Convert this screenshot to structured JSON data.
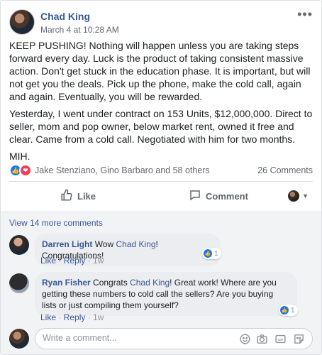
{
  "post": {
    "author": "Chad King",
    "timestamp": "March 4 at 10:28 AM",
    "more_icon": "more-horizontal-icon",
    "paragraphs": [
      "KEEP PUSHING! Nothing will happen unless you are taking steps forward every day. Luck is the product of taking consistent massive action. Don't get stuck in the education phase. It is important, but will not get you the deals. Pick up the phone, make the cold call, again and again. Eventually, you will be rewarded.",
      "Yesterday, I went under contract on 153 Units, $12,000,000. Direct to seller, mom and pop owner, below market rent, owned it free and clear. Came from a cold call. Negotiated with him for two months.",
      "MIH."
    ]
  },
  "reactions": {
    "icons": [
      "like-reaction-icon",
      "love-reaction-icon"
    ],
    "summary": "Jake Stenziano, Gino Barbaro and 58 others",
    "comment_count": "26 Comments"
  },
  "actions": {
    "like_label": "Like",
    "comment_label": "Comment"
  },
  "comments": {
    "view_more": "View 14 more comments",
    "items": [
      {
        "name": "Darren Light",
        "text_before": "Wow ",
        "tag": "Chad King",
        "text_after": "! Congratulations!",
        "like": "Like",
        "reply": "Reply",
        "time": "1w",
        "reaction_count": "1"
      },
      {
        "name": "Ryan Fisher",
        "text_before": "Congrats ",
        "tag": "Chad King",
        "text_after": "! Great work! Where are you getting these numbers to cold call the sellers? Are you buying lists or just compiling them yourself?",
        "like": "Like",
        "reply": "Reply",
        "time": "1w",
        "reaction_count": "1"
      }
    ]
  },
  "composer": {
    "placeholder": "Write a comment...",
    "icons": [
      "emoji-icon",
      "camera-icon",
      "gif-icon",
      "sticker-icon"
    ]
  },
  "colors": {
    "link": "#385898",
    "like_blue": "#1877f2",
    "love_red": "#f33e58",
    "muted": "#606770"
  }
}
